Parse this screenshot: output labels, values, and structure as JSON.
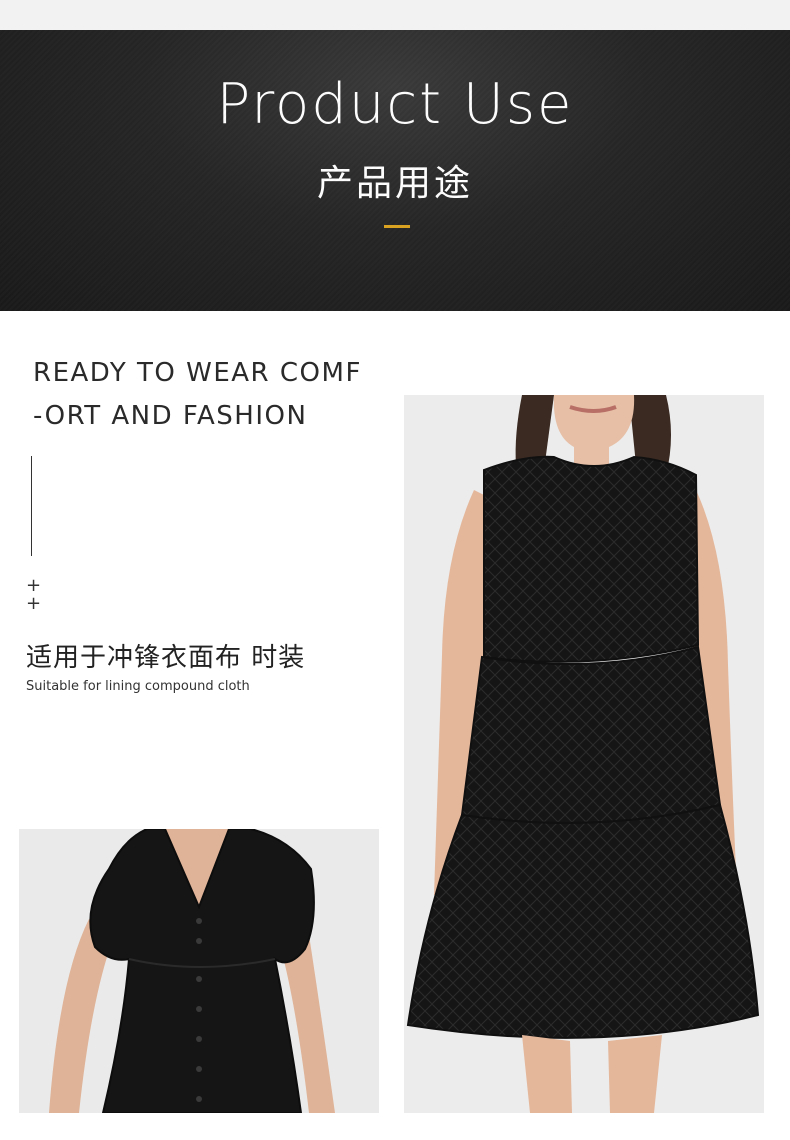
{
  "banner": {
    "title": "Product Use",
    "subtitle": "产品用途",
    "accent_color": "#d9a321"
  },
  "intro": {
    "headline_line1": "READY TO WEAR COMF",
    "headline_line2": "-ORT AND FASHION",
    "plus_marks": [
      "+",
      "+"
    ],
    "use_cn": "适用于冲锋衣面布 时装",
    "use_en": "Suitable for lining compound cloth"
  },
  "images": {
    "main": "black-sleeveless-tiered-dress-photo",
    "secondary": "black-v-neck-button-dress-photo"
  }
}
